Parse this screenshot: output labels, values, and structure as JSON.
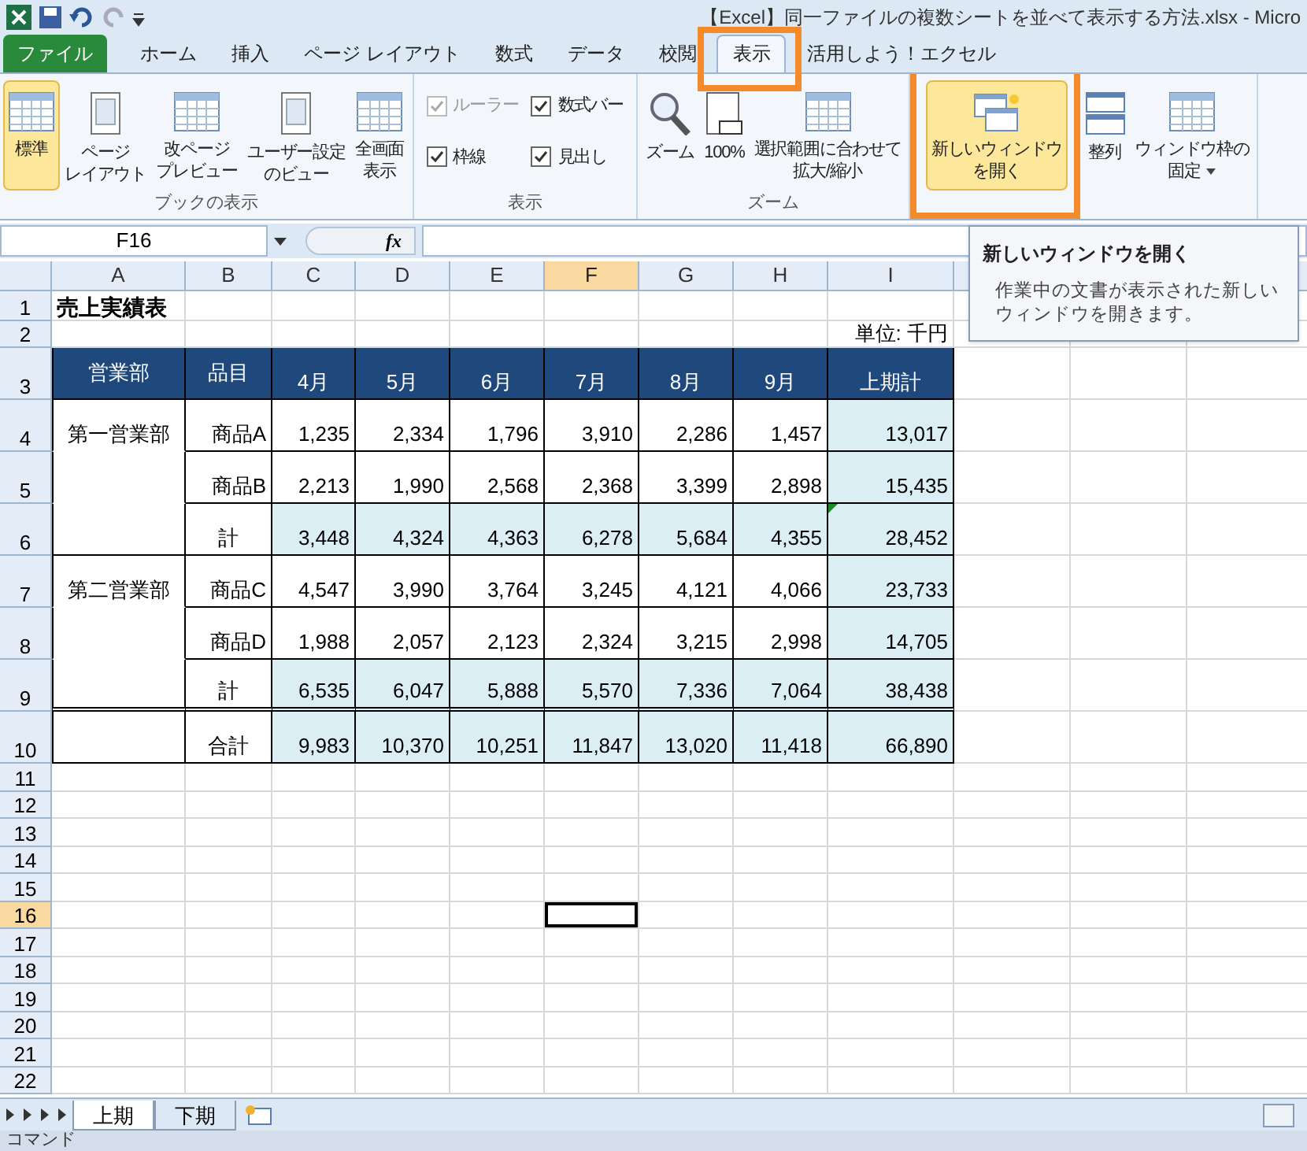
{
  "title_bar": {
    "title": "【Excel】同一ファイルの複数シートを並べて表示する方法.xlsx - Micro"
  },
  "ribbon_tabs": [
    {
      "label": "ファイル",
      "kind": "file",
      "selected": false
    },
    {
      "label": "ホーム",
      "kind": "tab",
      "selected": false
    },
    {
      "label": "挿入",
      "kind": "tab",
      "selected": false
    },
    {
      "label": "ページ レイアウト",
      "kind": "tab",
      "selected": false
    },
    {
      "label": "数式",
      "kind": "tab",
      "selected": false
    },
    {
      "label": "データ",
      "kind": "tab",
      "selected": false
    },
    {
      "label": "校閲",
      "kind": "tab",
      "selected": false
    },
    {
      "label": "表示",
      "kind": "tab",
      "selected": true
    },
    {
      "label": "活用しよう！エクセル",
      "kind": "tab",
      "selected": false
    }
  ],
  "ribbon_groups": [
    {
      "label": "ブックの表示",
      "items": [
        {
          "kind": "large",
          "lines": [
            "標準"
          ],
          "selected": true
        },
        {
          "kind": "large",
          "lines": [
            "ページ",
            "レイアウト"
          ],
          "selected": false
        },
        {
          "kind": "large",
          "lines": [
            "改ページ",
            "プレビュー"
          ],
          "selected": false
        },
        {
          "kind": "large",
          "lines": [
            "ユーザー設定",
            "のビュー"
          ],
          "selected": false
        },
        {
          "kind": "large",
          "lines": [
            "全画面",
            "表示"
          ],
          "selected": false
        }
      ]
    },
    {
      "label": "表示",
      "items": [
        {
          "kind": "checkbox",
          "label": "ルーラー",
          "checked": true,
          "disabled": true
        },
        {
          "kind": "checkbox",
          "label": "数式バー",
          "checked": true,
          "disabled": false
        },
        {
          "kind": "checkbox",
          "label": "枠線",
          "checked": true,
          "disabled": false
        },
        {
          "kind": "checkbox",
          "label": "見出し",
          "checked": true,
          "disabled": false
        }
      ]
    },
    {
      "label": "ズーム",
      "items": [
        {
          "kind": "large",
          "lines": [
            "ズーム"
          ],
          "selected": false
        },
        {
          "kind": "large",
          "lines": [
            "100%"
          ],
          "selected": false
        },
        {
          "kind": "large",
          "lines": [
            "選択範囲に合わせて",
            "拡大/縮小"
          ],
          "selected": false
        }
      ]
    },
    {
      "items": [
        {
          "kind": "large",
          "lines": [
            "新しいウィンドウ",
            "を開く"
          ],
          "selected": true,
          "highlighted": true
        },
        {
          "kind": "large",
          "lines": [
            "整列"
          ],
          "selected": false
        },
        {
          "kind": "large",
          "lines": [
            "ウィンドウ枠の",
            "固定"
          ],
          "selected": false,
          "dropdown": true
        }
      ]
    }
  ],
  "formula_bar": {
    "name_box": "F16",
    "function_label": "fx"
  },
  "tooltip": {
    "title": "新しいウィンドウを開く",
    "body": "作業中の文書が表示された新しいウィンドウを開きます。"
  },
  "sheet": {
    "columns": [
      {
        "label": "A",
        "selected": false
      },
      {
        "label": "B",
        "selected": false
      },
      {
        "label": "C",
        "selected": false
      },
      {
        "label": "D",
        "selected": false
      },
      {
        "label": "E",
        "selected": false
      },
      {
        "label": "F",
        "selected": true
      },
      {
        "label": "G",
        "selected": false
      },
      {
        "label": "H",
        "selected": false
      },
      {
        "label": "I",
        "selected": false
      }
    ],
    "rows": [
      {
        "label": "1",
        "selected": false,
        "cells": [
          {
            "text": "売上実績表",
            "kind": "title"
          },
          null,
          null,
          null,
          null,
          null,
          null,
          null,
          null
        ]
      },
      {
        "label": "2",
        "selected": false,
        "cells": [
          null,
          null,
          null,
          null,
          null,
          null,
          null,
          null,
          {
            "text": "単位: 千円",
            "kind": "unit"
          }
        ]
      },
      {
        "label": "3",
        "selected": false,
        "cells": [
          {
            "text": "営業部",
            "kind": "head_top"
          },
          {
            "text": "品目",
            "kind": "head_top"
          },
          {
            "text": "4月",
            "kind": "head"
          },
          {
            "text": "5月",
            "kind": "head"
          },
          {
            "text": "6月",
            "kind": "head"
          },
          {
            "text": "7月",
            "kind": "head"
          },
          {
            "text": "8月",
            "kind": "head"
          },
          {
            "text": "9月",
            "kind": "head"
          },
          {
            "text": "上期計",
            "kind": "head"
          }
        ]
      },
      {
        "label": "4",
        "selected": false,
        "cells": [
          {
            "text": "第一営業部",
            "kind": "merge_top"
          },
          {
            "text": "商品A",
            "kind": "label"
          },
          {
            "text": "1,235",
            "kind": "num"
          },
          {
            "text": "2,334",
            "kind": "num"
          },
          {
            "text": "1,796",
            "kind": "num"
          },
          {
            "text": "3,910",
            "kind": "num"
          },
          {
            "text": "2,286",
            "kind": "num"
          },
          {
            "text": "1,457",
            "kind": "num"
          },
          {
            "text": "13,017",
            "kind": "total"
          }
        ]
      },
      {
        "label": "5",
        "selected": false,
        "cells": [
          {
            "kind": "merge_mid"
          },
          {
            "text": "商品B",
            "kind": "label"
          },
          {
            "text": "2,213",
            "kind": "num"
          },
          {
            "text": "1,990",
            "kind": "num"
          },
          {
            "text": "2,568",
            "kind": "num"
          },
          {
            "text": "2,368",
            "kind": "num"
          },
          {
            "text": "3,399",
            "kind": "num"
          },
          {
            "text": "2,898",
            "kind": "num"
          },
          {
            "text": "15,435",
            "kind": "total"
          }
        ]
      },
      {
        "label": "6",
        "selected": false,
        "cells": [
          {
            "kind": "merge_end"
          },
          {
            "text": "計",
            "kind": "label_center"
          },
          {
            "text": "3,448",
            "kind": "total"
          },
          {
            "text": "4,324",
            "kind": "total"
          },
          {
            "text": "4,363",
            "kind": "total"
          },
          {
            "text": "6,278",
            "kind": "total"
          },
          {
            "text": "5,684",
            "kind": "total"
          },
          {
            "text": "4,355",
            "kind": "total"
          },
          {
            "text": "28,452",
            "kind": "total",
            "error_flag": true
          }
        ]
      },
      {
        "label": "7",
        "selected": false,
        "cells": [
          {
            "text": "第二営業部",
            "kind": "merge_top"
          },
          {
            "text": "商品C",
            "kind": "label"
          },
          {
            "text": "4,547",
            "kind": "num"
          },
          {
            "text": "3,990",
            "kind": "num"
          },
          {
            "text": "3,764",
            "kind": "num"
          },
          {
            "text": "3,245",
            "kind": "num"
          },
          {
            "text": "4,121",
            "kind": "num"
          },
          {
            "text": "4,066",
            "kind": "num"
          },
          {
            "text": "23,733",
            "kind": "total"
          }
        ]
      },
      {
        "label": "8",
        "selected": false,
        "cells": [
          {
            "kind": "merge_mid"
          },
          {
            "text": "商品D",
            "kind": "label"
          },
          {
            "text": "1,988",
            "kind": "num"
          },
          {
            "text": "2,057",
            "kind": "num"
          },
          {
            "text": "2,123",
            "kind": "num"
          },
          {
            "text": "2,324",
            "kind": "num"
          },
          {
            "text": "3,215",
            "kind": "num"
          },
          {
            "text": "2,998",
            "kind": "num"
          },
          {
            "text": "14,705",
            "kind": "total"
          }
        ]
      },
      {
        "label": "9",
        "selected": false,
        "cells": [
          {
            "kind": "merge_end"
          },
          {
            "text": "計",
            "kind": "label_center"
          },
          {
            "text": "6,535",
            "kind": "total"
          },
          {
            "text": "6,047",
            "kind": "total"
          },
          {
            "text": "5,888",
            "kind": "total"
          },
          {
            "text": "5,570",
            "kind": "total"
          },
          {
            "text": "7,336",
            "kind": "total"
          },
          {
            "text": "7,064",
            "kind": "total"
          },
          {
            "text": "38,438",
            "kind": "total"
          }
        ],
        "double_bottom": true
      },
      {
        "label": "10",
        "selected": false,
        "cells": [
          {
            "kind": "blank"
          },
          {
            "text": "合計",
            "kind": "label_center"
          },
          {
            "text": "9,983",
            "kind": "total"
          },
          {
            "text": "10,370",
            "kind": "total"
          },
          {
            "text": "10,251",
            "kind": "total"
          },
          {
            "text": "11,847",
            "kind": "total"
          },
          {
            "text": "13,020",
            "kind": "total"
          },
          {
            "text": "11,418",
            "kind": "total"
          },
          {
            "text": "66,890",
            "kind": "total"
          }
        ]
      },
      {
        "label": "11",
        "selected": false
      },
      {
        "label": "12",
        "selected": false
      },
      {
        "label": "13",
        "selected": false
      },
      {
        "label": "14",
        "selected": false
      },
      {
        "label": "15",
        "selected": false
      },
      {
        "label": "16",
        "selected": true
      },
      {
        "label": "17",
        "selected": false
      },
      {
        "label": "18",
        "selected": false
      },
      {
        "label": "19",
        "selected": false
      },
      {
        "label": "20",
        "selected": false
      },
      {
        "label": "21",
        "selected": false
      },
      {
        "label": "22",
        "selected": false
      }
    ]
  },
  "sheet_tabs": [
    {
      "label": "上期",
      "selected": true
    },
    {
      "label": "下期",
      "selected": false
    }
  ],
  "status_bar": {
    "mode": "コマンド"
  }
}
